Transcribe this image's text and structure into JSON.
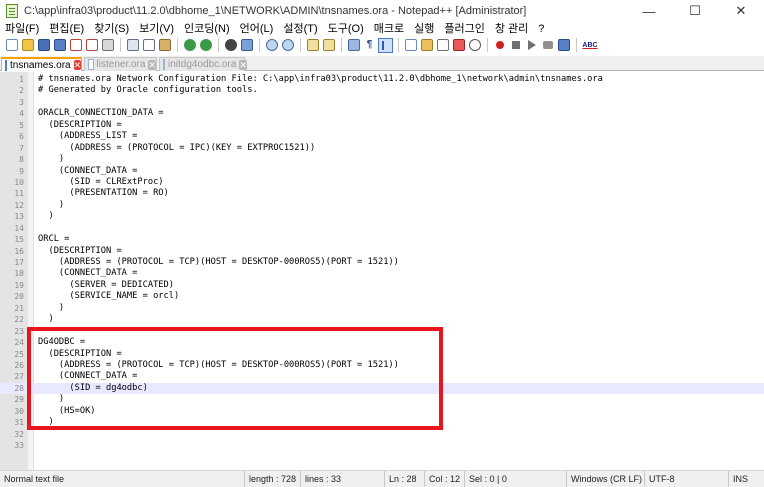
{
  "window": {
    "title": "C:\\app\\infra03\\product\\11.2.0\\dbhome_1\\NETWORK\\ADMIN\\tnsnames.ora - Notepad++ [Administrator]",
    "minimize": "—",
    "maximize": "☐",
    "close": "✕"
  },
  "menu": [
    "파일(F)",
    "편집(E)",
    "찾기(S)",
    "보기(V)",
    "인코딩(N)",
    "언어(L)",
    "설정(T)",
    "도구(O)",
    "매크로",
    "실행",
    "플러그인",
    "창 관리",
    "?"
  ],
  "tabs": [
    {
      "label": "tnsnames.ora",
      "active": true
    },
    {
      "label": "listener.ora",
      "active": false
    },
    {
      "label": "initdg4odbc.ora",
      "active": false
    }
  ],
  "editor": {
    "current_line": 28,
    "lines": [
      "# tnsnames.ora Network Configuration File: C:\\app\\infra03\\product\\11.2.0\\dbhome_1\\network\\admin\\tnsnames.ora",
      "# Generated by Oracle configuration tools.",
      "",
      "ORACLR_CONNECTION_DATA =",
      "  (DESCRIPTION =",
      "    (ADDRESS_LIST =",
      "      (ADDRESS = (PROTOCOL = IPC)(KEY = EXTPROC1521))",
      "    )",
      "    (CONNECT_DATA =",
      "      (SID = CLRExtProc)",
      "      (PRESENTATION = RO)",
      "    )",
      "  )",
      "",
      "ORCL =",
      "  (DESCRIPTION =",
      "    (ADDRESS = (PROTOCOL = TCP)(HOST = DESKTOP-000ROS5)(PORT = 1521))",
      "    (CONNECT_DATA =",
      "      (SERVER = DEDICATED)",
      "      (SERVICE_NAME = orcl)",
      "    )",
      "  )",
      "",
      "DG4ODBC =",
      "  (DESCRIPTION =",
      "    (ADDRESS = (PROTOCOL = TCP)(HOST = DESKTOP-000ROS5)(PORT = 1521))",
      "    (CONNECT_DATA =",
      "      (SID = dg4odbc)",
      "    )",
      "    (HS=OK)",
      "  )",
      "",
      ""
    ]
  },
  "status": {
    "file_type": "Normal text file",
    "length": "length : 728",
    "lines": "lines : 33",
    "ln": "Ln : 28",
    "col": "Col : 12",
    "sel": "Sel : 0 | 0",
    "eol": "Windows (CR LF)",
    "encoding": "UTF-8",
    "mode": "INS"
  },
  "colors": {
    "highlight_border": "#e8141e",
    "active_tab_accent": "#f9a300",
    "current_line_bg": "#e8e8ff"
  },
  "toolbar_icons": [
    "new-file-icon",
    "open-file-icon",
    "save-icon",
    "save-all-icon",
    "close-icon",
    "close-all-icon",
    "print-icon",
    "cut-icon",
    "copy-icon",
    "paste-icon",
    "undo-icon",
    "redo-icon",
    "find-icon",
    "replace-icon",
    "zoom-in-icon",
    "zoom-out-icon",
    "sync-vertical-icon",
    "sync-horizontal-icon",
    "word-wrap-icon",
    "show-all-chars-icon",
    "indent-guide-icon",
    "define-language-icon",
    "doc-map-icon",
    "function-list-icon",
    "folder-workspace-icon",
    "monitoring-icon",
    "record-macro-icon",
    "stop-macro-icon",
    "play-macro-icon",
    "play-multiple-icon",
    "save-macro-icon",
    "spell-check-icon"
  ],
  "toolbar_glyphs": {
    "show_all_chars": "¶",
    "spell_check": "ABC"
  }
}
